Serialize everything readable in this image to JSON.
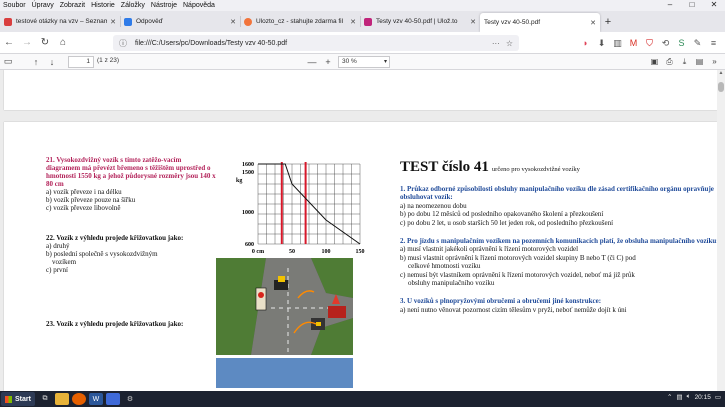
{
  "menu": [
    "Soubor",
    "Úpravy",
    "Zobrazit",
    "Historie",
    "Záložky",
    "Nástroje",
    "Nápověda"
  ],
  "tabs": [
    {
      "label": "testové otázky na vzv – Seznam",
      "color": "#d93f3f",
      "active": false
    },
    {
      "label": "Odpověď",
      "color": "#2f7be8",
      "active": false
    },
    {
      "label": "Ulozto_cz - stahujte zdarma fil",
      "color": "#f2743b",
      "active": false
    },
    {
      "label": "Testy vzv 40-50.pdf | Ulož.to",
      "color": "#c0247a",
      "active": false
    },
    {
      "label": "Testy vzv 40-50.pdf",
      "color": "#ffffff",
      "active": true
    }
  ],
  "navbar": {
    "url": "file:///C:/Users/pc/Downloads/Testy vzv 40-50.pdf"
  },
  "pdf_toolbar": {
    "page": "1",
    "page_of": "(1 z 23)",
    "zoom": "30 %"
  },
  "left": {
    "q21": {
      "title": "21. Vysokozdvižný vozík s tímto zatěžo-vacím diagramem má převézt břemeno s těžištěm uprostřed o hmotnosti 1550 kg a jehož půdorysné rozměry jsou 140 x 80 cm",
      "a": "a) vozík převeze i na délku",
      "b": "b) vozík převeze pouze na šířku",
      "c": "c) vozík převeze libovolně"
    },
    "q22": {
      "title": "22. Vozík z výhledu projede křižovatkou jako:",
      "a": "a) druhý",
      "b": "b) poslední společně s vysokozdvižným",
      "b2": "vozíkem",
      "c": "c) první"
    },
    "q23": {
      "title": "23. Vozík z výhledu projede křižovatkou jako:"
    }
  },
  "chart_data": {
    "type": "line",
    "title": "",
    "xlabel": "",
    "ylabel": "kg",
    "y_ticks": [
      "1600",
      "1500",
      "1000",
      "600"
    ],
    "x_ticks": [
      "0 cm",
      "50",
      "100",
      "150"
    ],
    "x": [
      0,
      40,
      50,
      100,
      150
    ],
    "y": [
      1600,
      1600,
      1350,
      900,
      600
    ],
    "xlim": [
      0,
      150
    ],
    "ylim": [
      600,
      1600
    ],
    "markers_x": [
      35,
      70
    ],
    "grid": true
  },
  "right": {
    "title": "TEST číslo 41",
    "subtitle": "určeno pro vysokozdvižné vozíky",
    "q1": {
      "title": "1. Průkaz odborné způsobilosti obsluhy manipulačního vozíku dle zásad certifikačního orgánu opravňuje obsluhovat vozík:",
      "a": "a) na neomezenou dobu",
      "b": "b) po dobu 12 měsíců od posledního opakovaného školení a přezkoušení",
      "c": "c) po dobu 2 let, u osob starších 50 let jeden rok, od posledního přezkoušení"
    },
    "q2": {
      "title": "2. Pro jízdu s manipulačním vozíkem na pozemních komunikacích platí, že obsluha manipulačního vozíku:",
      "a": "a) musí vlastnit jakékoli oprávnění k řízení motorových vozidel",
      "b": "b) musí vlastnit oprávnění k řízení motorových vozidel skupiny B nebo T (či C) pod",
      "b2": "celkové hmotnosti vozíku",
      "c": "c) nemusí být vlastníkem oprávnění k řízení motorových vozidel, neboť má již průk",
      "c2": "obsluhy manipulačního vozíku"
    },
    "q3": {
      "title": "3. U vozíků s plnopryžovými obručemi a obručemi jiné konstrukce:",
      "a": "a) není nutno věnovat pozornost cizím tělesům v pryži, neboť nemůže dojít k úni"
    },
    "taskbar": {
      "start": "Start",
      "time": "20:15"
    }
  }
}
